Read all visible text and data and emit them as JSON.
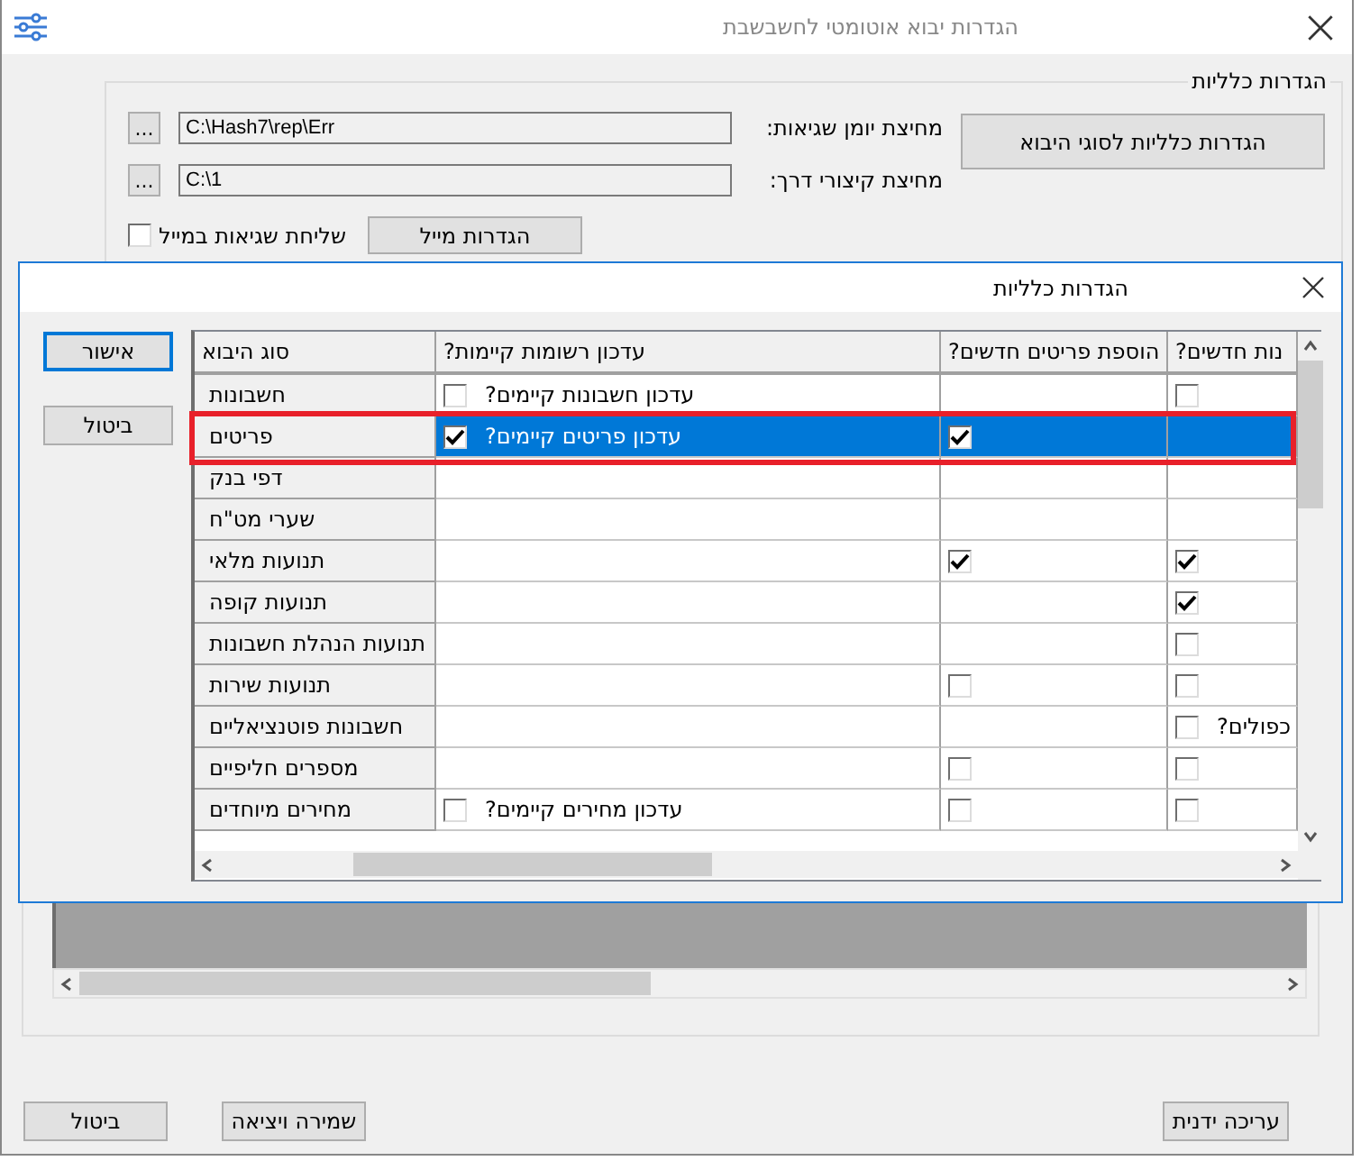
{
  "window": {
    "title": "הגדרות יבוא אוטומטי לחשבשבת"
  },
  "general_group": {
    "title": "הגדרות כלליות",
    "error_log_folder": {
      "label": "מחיצת יומן שגיאות:",
      "value": "C:\\Hash7\\rep\\Err",
      "browse": "..."
    },
    "shortcuts_folder": {
      "label": "מחיצת קיצורי דרך:",
      "value": "C:\\1",
      "browse": "..."
    },
    "send_errors_by_mail": {
      "label": "שליחת שגיאות במייל",
      "checked": false
    },
    "mail_settings_button": "הגדרות מייל",
    "import_types_button": "הגדרות כלליות לסוגי היבוא"
  },
  "bottom_buttons": [
    "עריכה ידנית",
    "שמירה ויציאה",
    "ביטול"
  ],
  "dialog": {
    "title": "הגדרות כלליות",
    "buttons": [
      {
        "label": "אישור",
        "default": true
      },
      {
        "label": "ביטול",
        "default": false
      }
    ],
    "columns": [
      "נות חדשים?",
      "הוספת פריטים חדשים?",
      "עדכון רשומות קיימות?",
      "סוג היבוא"
    ],
    "rows": [
      {
        "type": "חשבונות",
        "selected": false,
        "highlighted": false,
        "update": {
          "label": "עדכון חשבונות קיימים?",
          "checked": false
        },
        "add": null,
        "col4": {
          "checked": false
        }
      },
      {
        "type": "פריטים",
        "selected": true,
        "highlighted": true,
        "update": {
          "label": "עדכון פריטים קיימים?",
          "checked": true
        },
        "add": {
          "checked": true
        },
        "col4": null
      },
      {
        "type": "דפי בנק",
        "selected": false,
        "highlighted": false,
        "update": null,
        "add": null,
        "col4": null
      },
      {
        "type": "שערי מט\"ח",
        "selected": false,
        "highlighted": false,
        "update": null,
        "add": null,
        "col4": null
      },
      {
        "type": "תנועות מלאי",
        "selected": false,
        "highlighted": false,
        "update": null,
        "add": {
          "checked": true
        },
        "col4": {
          "checked": true
        }
      },
      {
        "type": "תנועות קופה",
        "selected": false,
        "highlighted": false,
        "update": null,
        "add": null,
        "col4": {
          "checked": true
        }
      },
      {
        "type": "תנועות הנהלת חשבונות",
        "selected": false,
        "highlighted": false,
        "update": null,
        "add": null,
        "col4": {
          "checked": false
        }
      },
      {
        "type": "תנועות שירות",
        "selected": false,
        "highlighted": false,
        "update": null,
        "add": {
          "checked": false
        },
        "col4": {
          "checked": false
        }
      },
      {
        "type": "חשבונות פוטנציאליים",
        "selected": false,
        "highlighted": false,
        "update": null,
        "add": null,
        "col4": {
          "label": "כפולים?",
          "checked": false
        }
      },
      {
        "type": "מספרים חליפיים",
        "selected": false,
        "highlighted": false,
        "update": null,
        "add": {
          "checked": false
        },
        "col4": {
          "checked": false
        }
      },
      {
        "type": "מחירים מיוחדים",
        "selected": false,
        "highlighted": false,
        "update": {
          "label": "עדכון מחירים קיימים?",
          "checked": false
        },
        "add": {
          "checked": false
        },
        "col4": {
          "checked": false
        }
      }
    ]
  }
}
